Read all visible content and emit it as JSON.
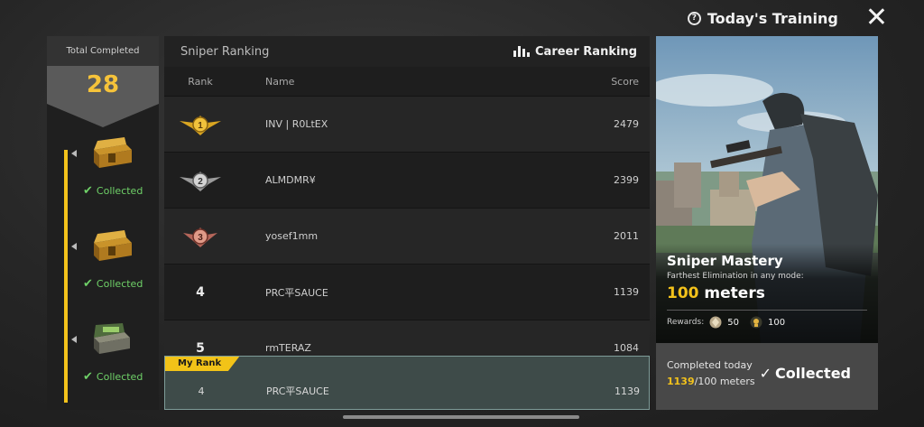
{
  "header": {
    "title": "Today's Training",
    "help_icon": "help-circle-icon",
    "close_icon": "close-icon"
  },
  "progress": {
    "label": "Total Completed",
    "value": "28",
    "rewards": [
      {
        "status": "Collected",
        "icon": "chest-icon"
      },
      {
        "status": "Collected",
        "icon": "chest-icon"
      },
      {
        "status": "Collected",
        "icon": "chest-icon"
      }
    ]
  },
  "ranking": {
    "title": "Sniper Ranking",
    "career_label": "Career Ranking",
    "columns": {
      "rank": "Rank",
      "name": "Name",
      "score": "Score"
    },
    "rows": [
      {
        "rank": "1",
        "name": "INV | R0LtEX",
        "score": "2479",
        "medal": "gold"
      },
      {
        "rank": "2",
        "name": "ALMDMR¥",
        "score": "2399",
        "medal": "silver"
      },
      {
        "rank": "3",
        "name": "yosef1mm",
        "score": "2011",
        "medal": "bronze"
      },
      {
        "rank": "4",
        "name": "PRC平SAUCE",
        "score": "1139",
        "medal": ""
      },
      {
        "rank": "5",
        "name": "rmTERAZ",
        "score": "1084",
        "medal": ""
      }
    ],
    "my_rank": {
      "tag": "My Rank",
      "rank": "4",
      "name": "PRC平SAUCE",
      "score": "1139"
    }
  },
  "challenge": {
    "title": "Sniper Mastery",
    "description": "Farthest Elimination in any mode:",
    "target_value": "100",
    "target_unit": "meters",
    "rewards_label": "Rewards:",
    "reward_items": [
      {
        "icon": "coin-icon",
        "value": "50"
      },
      {
        "icon": "badge-icon",
        "value": "100"
      }
    ],
    "completed_label": "Completed today",
    "completed_value": "1139",
    "completed_suffix": "/100 meters",
    "status": "Collected"
  },
  "colors": {
    "accent": "#f3c21b",
    "collected": "#6fd168",
    "my_rank_bg": "#3e4b49"
  }
}
